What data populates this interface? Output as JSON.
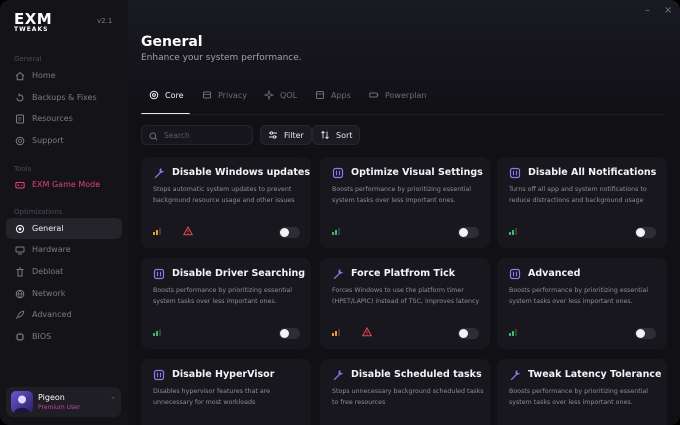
{
  "app": {
    "logo_main": "EXM",
    "logo_sub": "TWEAKS",
    "version": "v2.1"
  },
  "sidebar": {
    "sections": [
      {
        "label": "General"
      },
      {
        "label": "Tools"
      },
      {
        "label": "Optimizations"
      }
    ],
    "items": [
      {
        "label": "Home",
        "icon": "home-icon"
      },
      {
        "label": "Backups & Fixes",
        "icon": "backup-icon"
      },
      {
        "label": "Resources",
        "icon": "resources-icon"
      },
      {
        "label": "Support",
        "icon": "support-icon"
      },
      {
        "label": "EXM Game Mode",
        "icon": "gamepad-icon",
        "color": "#e8407a"
      },
      {
        "label": "General",
        "icon": "gear-icon",
        "active": true
      },
      {
        "label": "Hardware",
        "icon": "hardware-icon"
      },
      {
        "label": "Debloat",
        "icon": "trash-icon"
      },
      {
        "label": "Network",
        "icon": "network-icon"
      },
      {
        "label": "Advanced",
        "icon": "rocket-icon"
      },
      {
        "label": "BIOS",
        "icon": "chip-icon"
      }
    ],
    "user": {
      "name": "Pigeon",
      "role": "Premium User"
    }
  },
  "window": {
    "minimize_label": "–",
    "close_label": "×"
  },
  "header": {
    "title": "General",
    "subtitle": "Enhance your system performance."
  },
  "tabs": [
    {
      "label": "Core",
      "icon": "core-icon",
      "active": true
    },
    {
      "label": "Privacy",
      "icon": "privacy-icon"
    },
    {
      "label": "QOL",
      "icon": "qol-icon"
    },
    {
      "label": "Apps",
      "icon": "apps-icon"
    },
    {
      "label": "Powerplan",
      "icon": "battery-icon"
    }
  ],
  "toolbar": {
    "search_placeholder": "Search",
    "filter_label": "Filter",
    "sort_label": "Sort"
  },
  "colors": {
    "accent_purple": "#8a7cf0",
    "impact_green": "#37c26a",
    "impact_orange": "#f0a020",
    "warning_red": "#e04a5a",
    "game_mode": "#e8407a"
  },
  "tweaks": [
    {
      "title": "Disable Windows updates",
      "desc": "Stops automatic system updates to prevent background resource usage and other issues",
      "icon": "gear-icon",
      "impact": "medium",
      "warning": true,
      "enabled": false
    },
    {
      "title": "Optimize Visual Settings",
      "desc": "Boosts performance by prioritizing essential system tasks over less important ones.",
      "icon": "chip-icon",
      "impact": "low",
      "warning": false,
      "enabled": false
    },
    {
      "title": "Disable All Notifications",
      "desc": "Turns off all app and system notifications to reduce distractions and background usage",
      "icon": "chip-icon",
      "impact": "low",
      "warning": false,
      "enabled": false
    },
    {
      "title": "Disable Driver Searching",
      "desc": "Boosts performance by prioritizing essential system tasks over less important ones.",
      "icon": "chip-icon",
      "impact": "low",
      "warning": false,
      "enabled": false
    },
    {
      "title": "Force Platfrom Tick",
      "desc": "Forces Windows to use the platform timer (HPET/LAPIC) instead of TSC, improves latency",
      "icon": "wrench-icon",
      "impact": "medium",
      "warning": true,
      "enabled": false
    },
    {
      "title": "Advanced",
      "desc": "Boosts performance by prioritizing essential system tasks over less important ones.",
      "icon": "chip-icon",
      "impact": "low",
      "warning": false,
      "enabled": false
    },
    {
      "title": "Disable HyperVisor",
      "desc": "Disables hypervisor features that are unnecessary for most workloads",
      "icon": "chip-icon",
      "impact": null,
      "warning": false,
      "enabled": false
    },
    {
      "title": "Disable Scheduled tasks",
      "desc": "Stops unnecessary background scheduled tasks to free resources",
      "icon": "wrench-icon",
      "impact": null,
      "warning": false,
      "enabled": false
    },
    {
      "title": "Tweak Latency Tolerance",
      "desc": "Boosts performance by prioritizing essential system tasks over less important ones.",
      "icon": "wrench-icon",
      "impact": null,
      "warning": false,
      "enabled": false
    }
  ]
}
